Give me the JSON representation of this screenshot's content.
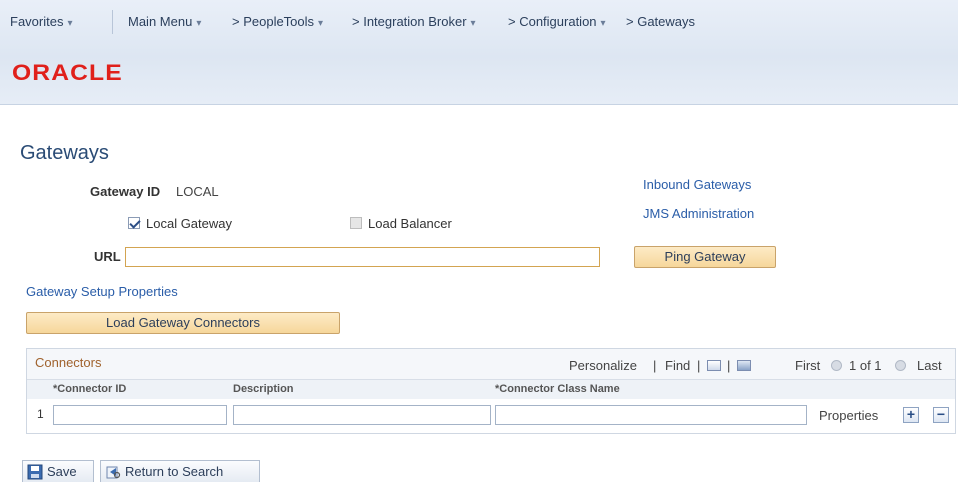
{
  "breadcrumbs": {
    "favorites": "Favorites",
    "main_menu": "Main Menu",
    "peopletools": "> PeopleTools",
    "integration_broker": "> Integration Broker",
    "configuration": "> Configuration",
    "gateways": "> Gateways"
  },
  "brand": {
    "logo": "ORACLE",
    "color": "#e0201b"
  },
  "page": {
    "title": "Gateways"
  },
  "form": {
    "gateway_id_label": "Gateway ID",
    "gateway_id_value": "LOCAL",
    "local_gateway_label": "Local Gateway",
    "local_gateway_checked": true,
    "load_balancer_label": "Load Balancer",
    "load_balancer_checked": false,
    "url_label": "URL",
    "url_value": ""
  },
  "links": {
    "inbound_gateways": "Inbound Gateways",
    "jms_administration": "JMS Administration",
    "gateway_setup_properties": "Gateway Setup Properties"
  },
  "buttons": {
    "ping_gateway": "Ping Gateway",
    "load_gateway_connectors": "Load Gateway Connectors",
    "save": "Save",
    "return_to_search": "Return to Search"
  },
  "connectors_grid": {
    "title": "Connectors",
    "personalize": "Personalize",
    "separator1": "|",
    "find": "Find",
    "separator2": "|",
    "separator3": "|",
    "first": "First",
    "range": "1 of 1",
    "last": "Last",
    "columns": {
      "connector_id": "*Connector ID",
      "description": "Description",
      "connector_class_name": "*Connector Class Name"
    },
    "rows": [
      {
        "num": "1",
        "connector_id": "",
        "description": "",
        "class_name": "",
        "properties_link": "Properties"
      }
    ],
    "add_symbol": "+",
    "remove_symbol": "−"
  }
}
